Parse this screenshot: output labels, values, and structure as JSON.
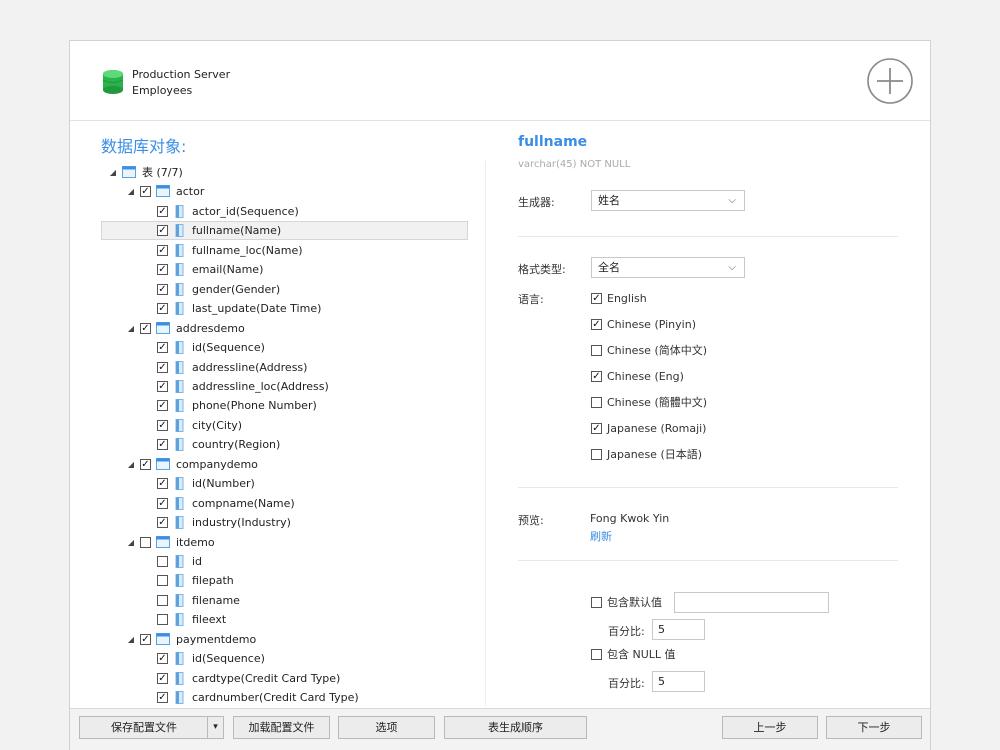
{
  "header": {
    "connection": "Production Server",
    "database": "Employees"
  },
  "left": {
    "title": "数据库对象:",
    "tree": [
      {
        "kind": "root",
        "label": "表 (7/7)",
        "expander": "◢",
        "checked": null
      },
      {
        "kind": "table",
        "label": "actor",
        "expander": "◢",
        "checked": true
      },
      {
        "kind": "col",
        "label": "actor_id(Sequence)",
        "checked": true
      },
      {
        "kind": "col",
        "label": "fullname(Name)",
        "checked": true,
        "selected": true
      },
      {
        "kind": "col",
        "label": "fullname_loc(Name)",
        "checked": true
      },
      {
        "kind": "col",
        "label": "email(Name)",
        "checked": true
      },
      {
        "kind": "col",
        "label": "gender(Gender)",
        "checked": true
      },
      {
        "kind": "col",
        "label": "last_update(Date Time)",
        "checked": true
      },
      {
        "kind": "table",
        "label": "addresdemo",
        "expander": "◢",
        "checked": true
      },
      {
        "kind": "col",
        "label": "id(Sequence)",
        "checked": true
      },
      {
        "kind": "col",
        "label": "addressline(Address)",
        "checked": true
      },
      {
        "kind": "col",
        "label": "addressline_loc(Address)",
        "checked": true
      },
      {
        "kind": "col",
        "label": "phone(Phone Number)",
        "checked": true
      },
      {
        "kind": "col",
        "label": "city(City)",
        "checked": true
      },
      {
        "kind": "col",
        "label": "country(Region)",
        "checked": true
      },
      {
        "kind": "table",
        "label": "companydemo",
        "expander": "◢",
        "checked": true
      },
      {
        "kind": "col",
        "label": "id(Number)",
        "checked": true
      },
      {
        "kind": "col",
        "label": "compname(Name)",
        "checked": true
      },
      {
        "kind": "col",
        "label": "industry(Industry)",
        "checked": true
      },
      {
        "kind": "table",
        "label": "itdemo",
        "expander": "◢",
        "checked": false
      },
      {
        "kind": "col",
        "label": "id",
        "checked": false
      },
      {
        "kind": "col",
        "label": "filepath",
        "checked": false
      },
      {
        "kind": "col",
        "label": "filename",
        "checked": false
      },
      {
        "kind": "col",
        "label": "fileext",
        "checked": false
      },
      {
        "kind": "table",
        "label": "paymentdemo",
        "expander": "◢",
        "checked": true
      },
      {
        "kind": "col",
        "label": "id(Sequence)",
        "checked": true
      },
      {
        "kind": "col",
        "label": "cardtype(Credit Card Type)",
        "checked": true
      },
      {
        "kind": "col",
        "label": "cardnumber(Credit Card Type)",
        "checked": true
      }
    ]
  },
  "right": {
    "field_name": "fullname",
    "field_type": "varchar(45) NOT NULL",
    "generator_label": "生成器:",
    "generator_value": "姓名",
    "format_label": "格式类型:",
    "format_value": "全名",
    "language_label": "语言:",
    "languages": [
      {
        "label": "English",
        "checked": true
      },
      {
        "label": "Chinese (Pinyin)",
        "checked": true
      },
      {
        "label": "Chinese (简体中文)",
        "checked": false
      },
      {
        "label": "Chinese (Eng)",
        "checked": true
      },
      {
        "label": "Chinese (簡體中文)",
        "checked": false
      },
      {
        "label": "Japanese (Romaji)",
        "checked": true
      },
      {
        "label": "Japanese (日本語)",
        "checked": false
      }
    ],
    "preview_label": "预览:",
    "preview_value": "Fong Kwok Yin",
    "refresh_label": "刷新",
    "include_default_label": "包含默认值",
    "include_default_checked": false,
    "include_default_value": "",
    "percent_label_1": "百分比:",
    "percent_value_1": "5",
    "include_null_label": "包含 NULL 值",
    "include_null_checked": false,
    "percent_label_2": "百分比:",
    "percent_value_2": "5"
  },
  "footer": {
    "save_profile": "保存配置文件",
    "save_dropdown": "▾",
    "load_profile": "加载配置文件",
    "options": "选项",
    "table_order": "表生成顺序",
    "prev": "上一步",
    "next": "下一步"
  },
  "colors": {
    "accent": "#3a8ee6",
    "db_icon": "#2bb24c"
  },
  "icons": {
    "header": "database-icon",
    "add": "add-circle-icon",
    "table": "table-icon",
    "column": "column-icon",
    "check": "checkmark"
  }
}
